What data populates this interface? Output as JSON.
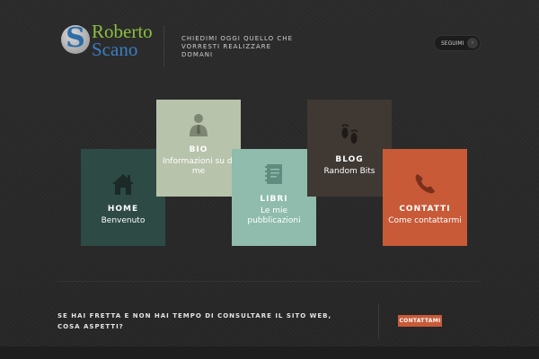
{
  "header": {
    "logo": {
      "letter": "S",
      "name_line1": "Roberto",
      "name_line2": "Scano"
    },
    "tagline": "CHIEDIMI OGGI QUELLO CHE VORRESTI REALIZZARE DOMANI",
    "follow_label": "SEGUIMI",
    "follow_arrow": "›"
  },
  "tiles": [
    {
      "title": "HOME",
      "subtitle": "Benvenuto",
      "icon": "house-icon",
      "color": "#2d4a45"
    },
    {
      "title": "BIO",
      "subtitle": "Informazioni su di me",
      "icon": "person-icon",
      "color": "#b8c3ab"
    },
    {
      "title": "LIBRI",
      "subtitle": "Le mie pubblicazioni",
      "icon": "book-icon",
      "color": "#8fbcad"
    },
    {
      "title": "BLOG",
      "subtitle": "Random Bits",
      "icon": "footprints-icon",
      "color": "#3f3833"
    },
    {
      "title": "CONTATTI",
      "subtitle": "Come contattarmi",
      "icon": "phone-icon",
      "color": "#c85a38"
    }
  ],
  "cta": {
    "text": "SE HAI FRETTA E NON HAI TEMPO DI CONSULTARE IL SITO WEB, COSA ASPETTI?",
    "button_label": "CONTATTAMI",
    "button_color": "#c85a38"
  }
}
